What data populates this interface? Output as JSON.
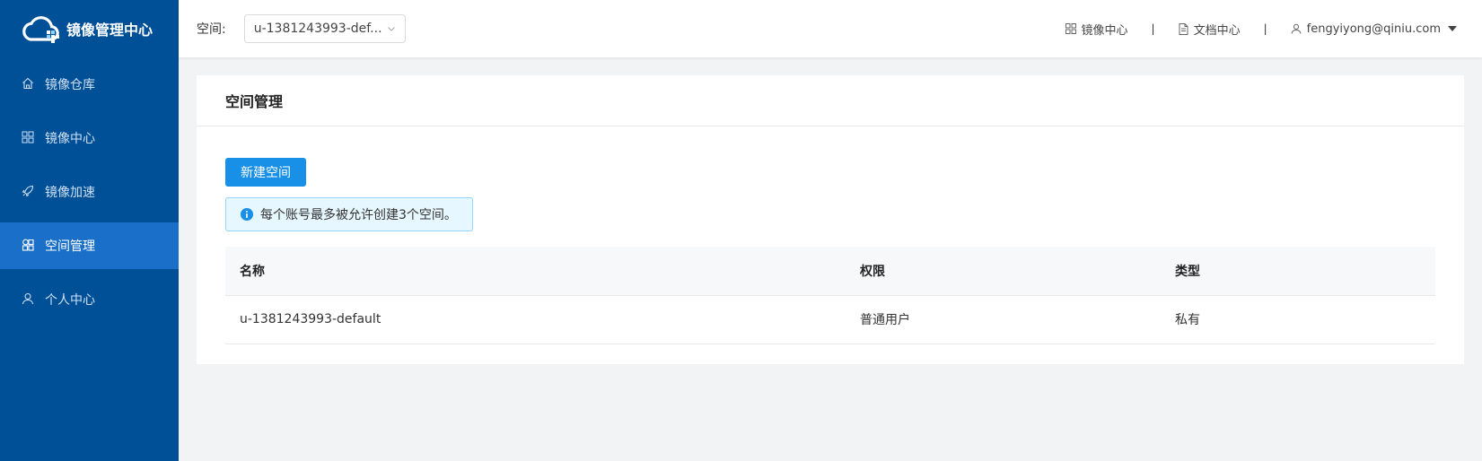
{
  "app": {
    "title": "镜像管理中心"
  },
  "sidebar": {
    "items": [
      {
        "label": "镜像仓库",
        "icon": "home-icon",
        "active": false
      },
      {
        "label": "镜像中心",
        "icon": "grid-icon",
        "active": false
      },
      {
        "label": "镜像加速",
        "icon": "rocket-icon",
        "active": false
      },
      {
        "label": "空间管理",
        "icon": "cubes-icon",
        "active": true
      },
      {
        "label": "个人中心",
        "icon": "user-icon",
        "active": false
      }
    ]
  },
  "header": {
    "space_label": "空间:",
    "space_select_value": "u-1381243993-def...",
    "links": [
      {
        "label": "镜像中心",
        "icon": "grid-icon"
      },
      {
        "label": "文档中心",
        "icon": "document-icon"
      }
    ],
    "separator": "|",
    "user": "fengyiyong@qiniu.com"
  },
  "main": {
    "title": "空间管理",
    "new_button": "新建空间",
    "alert": "每个账号最多被允许创建3个空间。",
    "table": {
      "headers": [
        "名称",
        "权限",
        "类型"
      ],
      "rows": [
        [
          "u-1381243993-default",
          "普通用户",
          "私有"
        ]
      ]
    }
  },
  "colors": {
    "sidebar_bg": "#005098",
    "sidebar_active": "#1a70c8",
    "primary": "#1890e8",
    "alert_bg": "#e6f7ff",
    "alert_border": "#91d5ff"
  }
}
